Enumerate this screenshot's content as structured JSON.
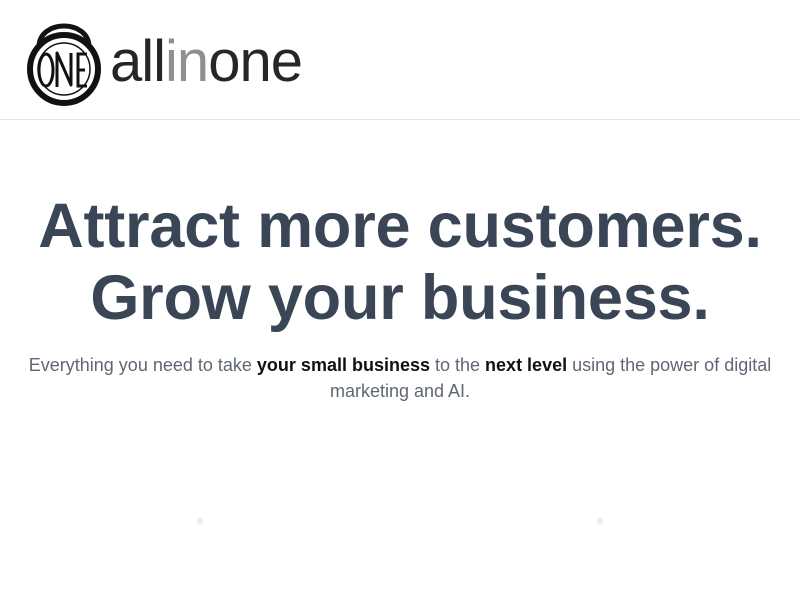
{
  "brand": {
    "logo_icon": "one-circle-logo-icon",
    "logo_text": "ONE",
    "word_part1": "all",
    "word_part2": "in",
    "word_part3": "one",
    "colors": {
      "dark": "#262626",
      "gray": "#8f8f8f"
    }
  },
  "hero": {
    "headline_line1": "Attract more customers.",
    "headline_line2": "Grow your business.",
    "subtitle": {
      "part1": "Everything you need to take ",
      "bold1": "your small business",
      "part2": " to the ",
      "bold2": "next level",
      "part3": " using the power of digital marketing and AI."
    },
    "colors": {
      "headline": "#3a4556",
      "subtitle": "#5f6775",
      "bold": "#111111"
    }
  }
}
